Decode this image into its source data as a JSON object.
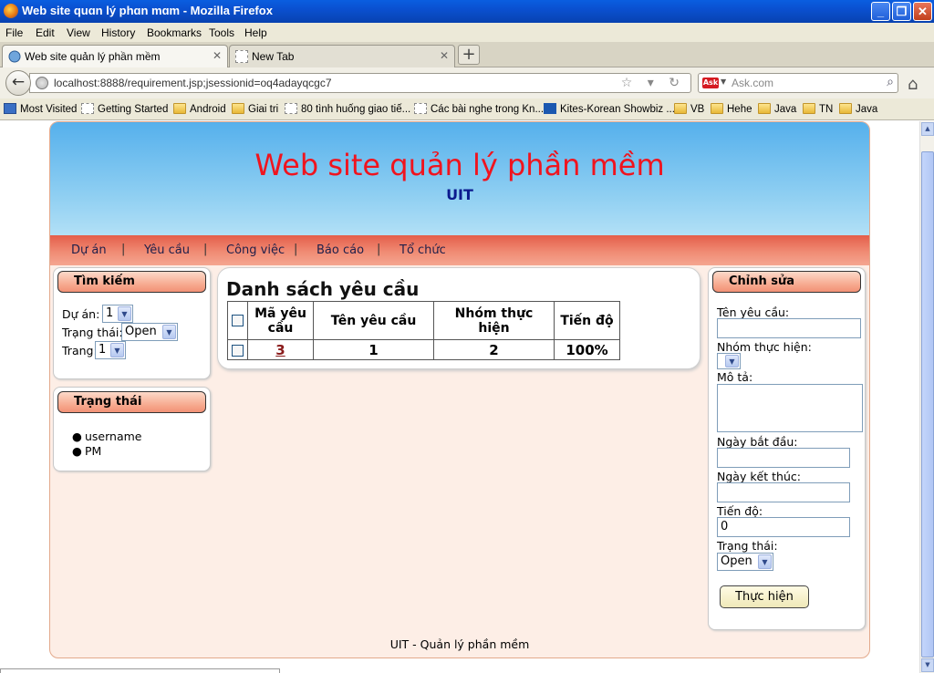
{
  "window": {
    "title": "Web site quɑn lý phɑn mɑm - Mozilla Firefox",
    "controls": [
      "_",
      "❐",
      "✕"
    ]
  },
  "menu": [
    "File",
    "Edit",
    "View",
    "History",
    "Bookmarks",
    "Tools",
    "Help"
  ],
  "tabs": [
    {
      "label": "Web site quản lý phần mềm",
      "close": "✕"
    },
    {
      "label": "New Tab",
      "close": "✕"
    }
  ],
  "new_tab_label": "+",
  "nav": {
    "back": "←",
    "url": "localhost:8888/requirement.jsp;jsessionid=oq4adayqcgc7",
    "url_icons": "☆ ▾ ↻",
    "search_engine_icon": "Ask",
    "search_placeholder": "Ask.com",
    "search_icon": "⌕",
    "home_icon": "⌂"
  },
  "bookmarks": [
    {
      "label": "Most Visited",
      "icon": "mv"
    },
    {
      "label": "Getting Started",
      "icon": "page"
    },
    {
      "label": "Android",
      "icon": "folder"
    },
    {
      "label": "Giai tri",
      "icon": "folder"
    },
    {
      "label": "80 tình huống giao tiế...",
      "icon": "page"
    },
    {
      "label": "Các bài nghe trong Kn...",
      "icon": "page"
    },
    {
      "label": "Kites-Korean Showbiz ...",
      "icon": "kites"
    },
    {
      "label": "VB",
      "icon": "folder"
    },
    {
      "label": "Hehe",
      "icon": "folder"
    },
    {
      "label": "Java",
      "icon": "folder"
    },
    {
      "label": "TN",
      "icon": "folder"
    },
    {
      "label": "Java",
      "icon": "folder"
    }
  ],
  "site": {
    "title": "Web site quản lý phần mềm",
    "subtitle": "UIT",
    "nav": [
      "Dự án",
      "Yêu cầu",
      "Công việc",
      "Báo cáo",
      "Tổ chức"
    ],
    "footer": "UIT - Quản lý phần mềm"
  },
  "search_box": {
    "title": "Tìm kiếm",
    "project_label": "Dự án:",
    "project_value": "1",
    "status_label": "Trạng thái:",
    "status_value": "Open",
    "page_label": "Trang:",
    "page_value": "1"
  },
  "status_box": {
    "title": "Trạng thái",
    "items": [
      "username",
      "PM"
    ]
  },
  "main": {
    "title": "Danh sách yêu cầu",
    "columns": [
      "Mã yêu cầu",
      "Tên yêu cầu",
      "Nhóm thực hiện",
      "Tiến độ"
    ],
    "rows": [
      {
        "id": "3",
        "name": "1",
        "group": "2",
        "progress": "100%"
      }
    ]
  },
  "edit_box": {
    "title": "Chỉnh sửa",
    "name_label": "Tên yêu cầu:",
    "name_value": "",
    "group_label": "Nhóm thực hiện:",
    "group_value": "",
    "desc_label": "Mô tả:",
    "desc_value": "",
    "start_label": "Ngày bắt đầu:",
    "start_value": "",
    "end_label": "Ngày kết thúc:",
    "end_value": "",
    "progress_label": "Tiến độ:",
    "progress_value": "0",
    "status_label": "Trạng thái:",
    "status_value": "Open",
    "submit_label": "Thực hiện"
  },
  "colors": {
    "site_title": "#f0141e",
    "subtitle": "#0b1a8e",
    "nav_bar": "#e45e4a",
    "page_bg": "#fdeee6"
  }
}
